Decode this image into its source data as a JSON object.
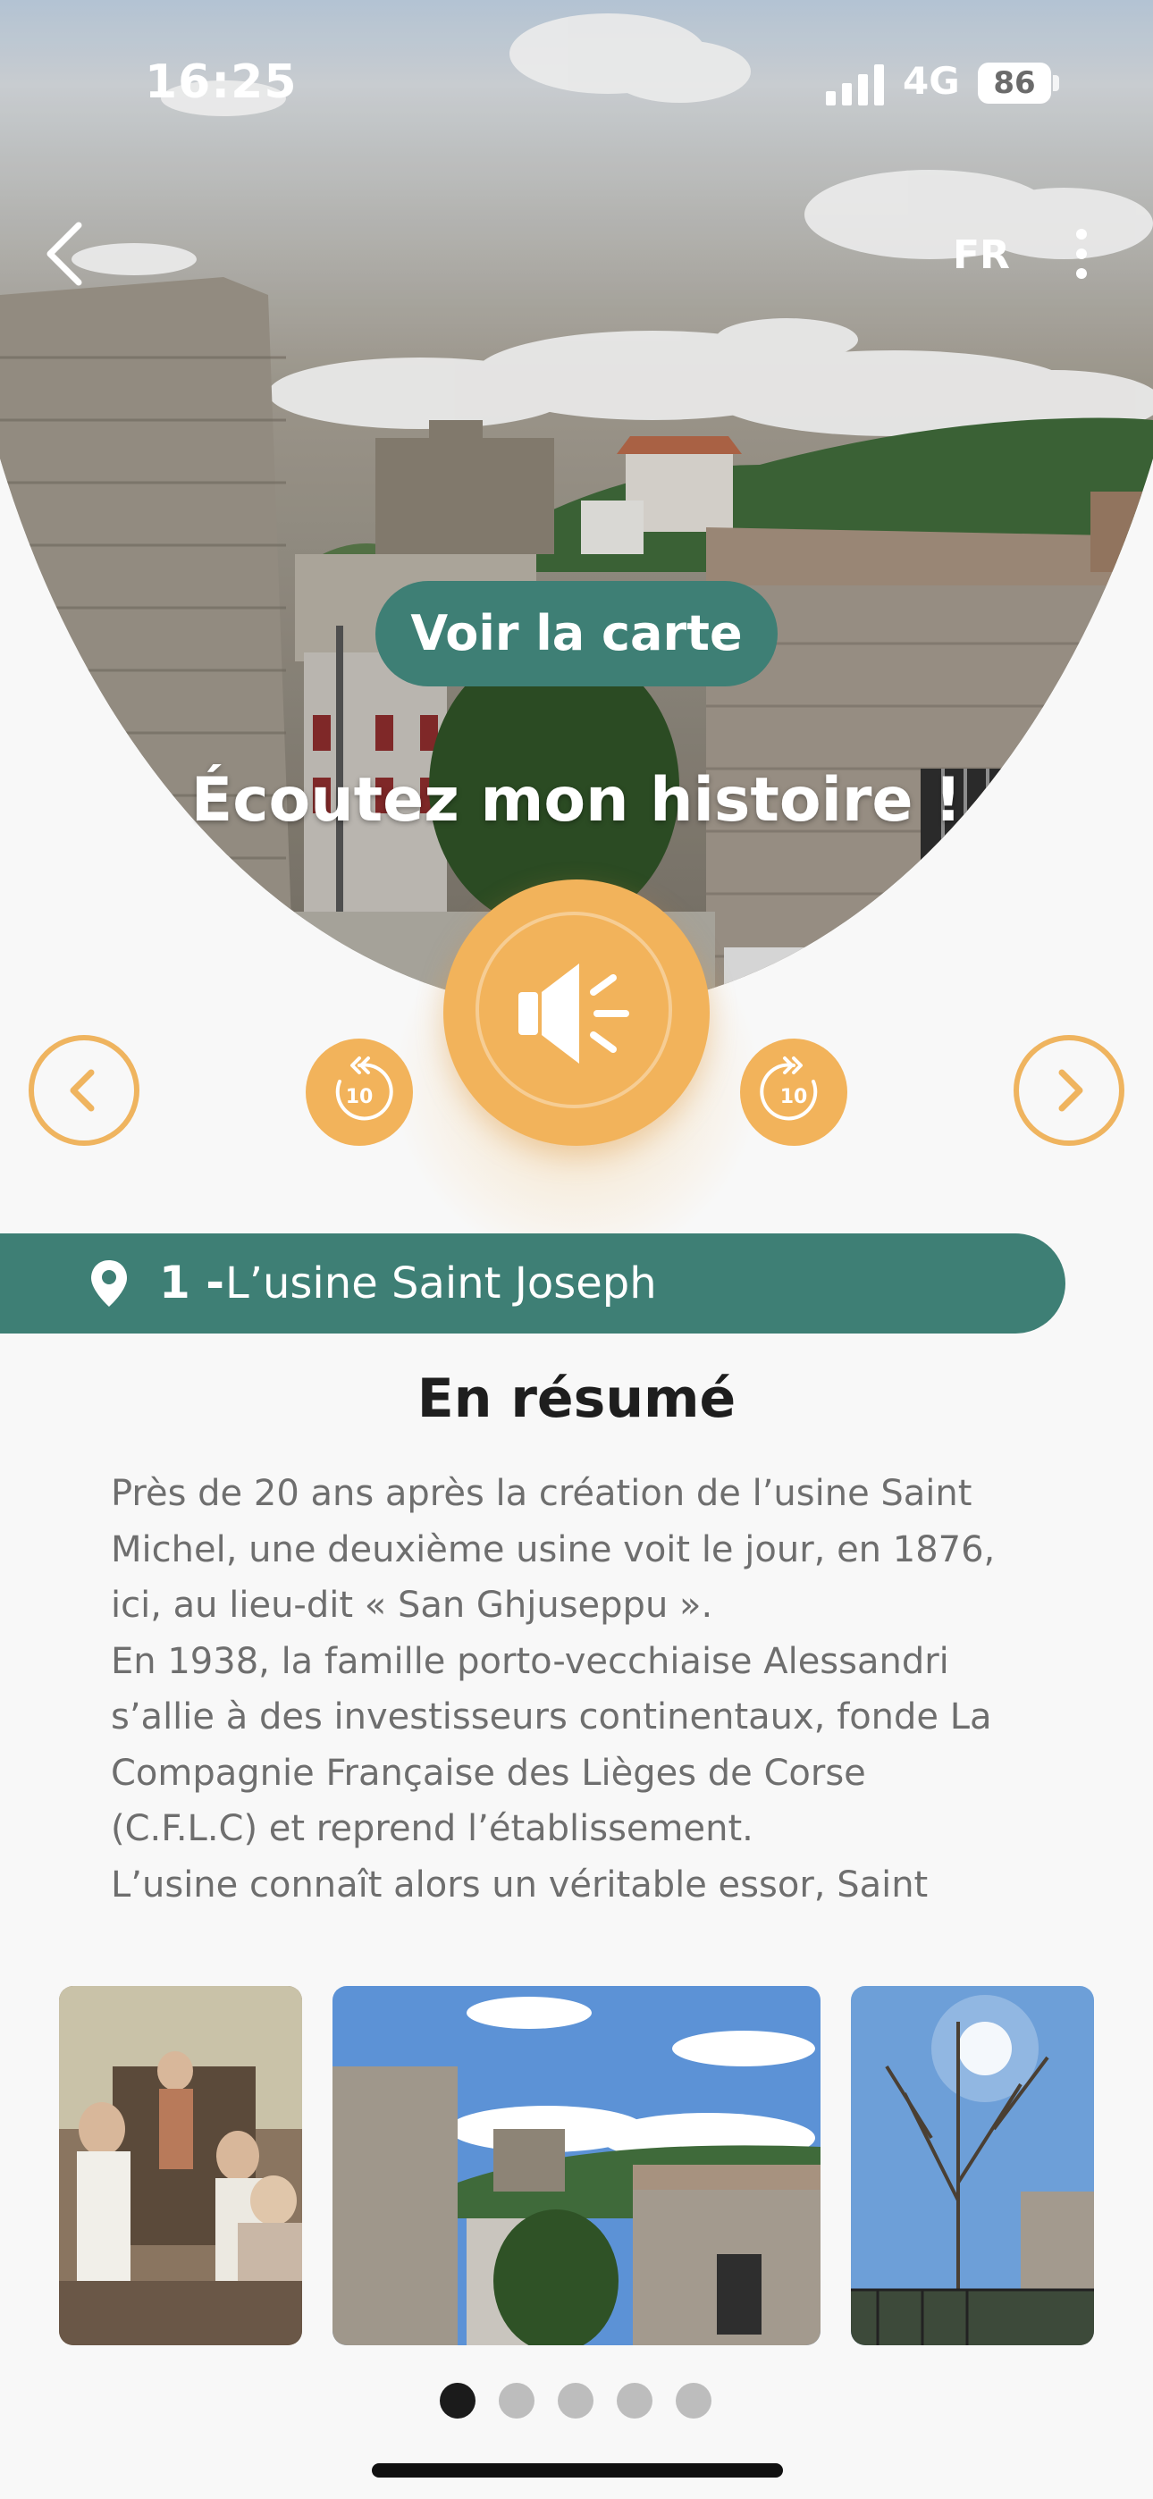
{
  "status_bar": {
    "time": "16:25",
    "network": "4G",
    "battery": "86"
  },
  "header": {
    "language": "FR"
  },
  "hero": {
    "map_button_label": "Voir la carte",
    "listen_title": "Écoutez mon histoire !",
    "skip_back_label": "10",
    "skip_forward_label": "10"
  },
  "stop": {
    "number": "1 -",
    "title": "L’usine Saint Joseph"
  },
  "summary": {
    "title": "En résumé",
    "lines": [
      "Près de 20 ans après la création de l’usine Saint",
      "Michel, une deuxième usine voit le jour, en 1876,",
      "ici, au lieu-dit « San Ghjuseppu ».",
      "En 1938, la famille porto-vecchiaise Alessandri",
      "s’allie à des investisseurs continentaux, fonde La",
      "Compagnie Française des Lièges de Corse",
      "(C.F.L.C) et reprend l’établissement.",
      "L’usine connaît alors un véritable essor, Saint"
    ]
  },
  "gallery": {
    "images": [
      "historic-photo",
      "stone-building-photo",
      "bare-tree-photo"
    ],
    "dots_total": 5,
    "active_dot": 0
  },
  "colors": {
    "teal": "#3e7f75",
    "orange": "#f2b35b",
    "background": "#f8f8f8"
  }
}
